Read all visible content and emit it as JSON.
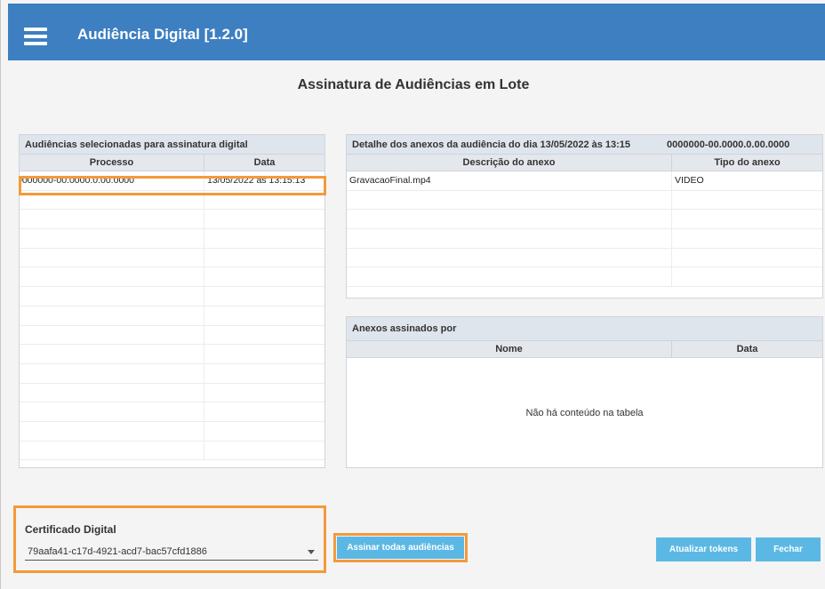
{
  "app": {
    "title": "Audiência Digital [1.2.0]"
  },
  "page": {
    "title": "Assinatura de Audiências em Lote"
  },
  "selected_panel": {
    "title": "Audiências selecionadas para assinatura digital",
    "columns": [
      "Processo",
      "Data"
    ],
    "rows": [
      {
        "processo": "0000000-00.0000.0.00.0000",
        "data": "13/05/2022 às 13:15:13"
      }
    ]
  },
  "detail_panel": {
    "title": "Detalhe dos anexos da audiência do dia  13/05/2022 às 13:15",
    "process_number": "0000000-00.0000.0.00.0000",
    "columns": [
      "Descrição do anexo",
      "Tipo do anexo"
    ],
    "rows": [
      {
        "descricao": "GravacaoFinal.mp4",
        "tipo": "VIDEO"
      }
    ]
  },
  "signed_panel": {
    "title": "Anexos assinados por",
    "columns": [
      "Nome",
      "Data"
    ],
    "empty_message": "Não há conteúdo na tabela"
  },
  "certificate": {
    "label": "Certificado Digital",
    "value": "79aafa41-c17d-4921-acd7-bac57cfd1886"
  },
  "buttons": {
    "sign_all": "Assinar todas audiências",
    "refresh_tokens": "Atualizar tokens",
    "close": "Fechar"
  },
  "colors": {
    "appbar": "#3d7fc1",
    "button": "#5bb8e4",
    "highlight": "#f39a3a"
  }
}
